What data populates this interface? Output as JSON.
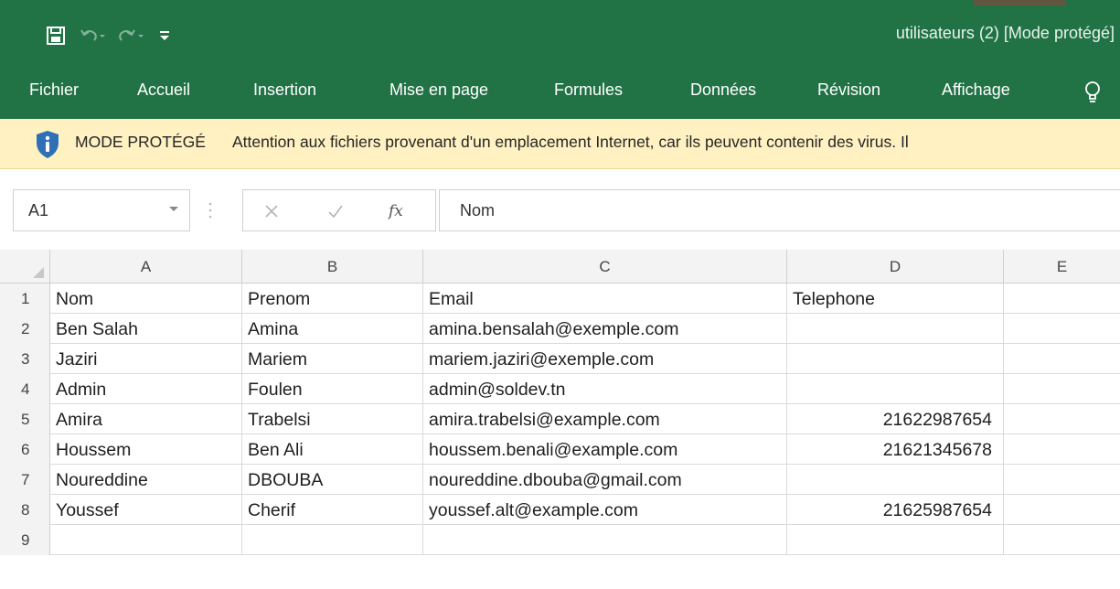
{
  "window": {
    "title": "utilisateurs (2)  [Mode protégé]"
  },
  "quick_access": {
    "save_icon": "save-icon",
    "undo_icon": "undo-icon",
    "redo_icon": "redo-icon",
    "customize_icon": "customize-qat-icon"
  },
  "ribbon": {
    "tabs": [
      {
        "label": "Fichier"
      },
      {
        "label": "Accueil"
      },
      {
        "label": "Insertion"
      },
      {
        "label": "Mise en page"
      },
      {
        "label": "Formules"
      },
      {
        "label": "Données"
      },
      {
        "label": "Révision"
      },
      {
        "label": "Affichage"
      }
    ],
    "tell_me_icon": "lightbulb-icon"
  },
  "protected_view": {
    "title": "MODE PROTÉGÉ",
    "message": "Attention aux fichiers provenant d'un emplacement Internet, car ils peuvent contenir des virus. Il"
  },
  "formula_bar": {
    "name_box": "A1",
    "formula": "Nom",
    "fx_label": "fx"
  },
  "sheet": {
    "columns": [
      "A",
      "B",
      "C",
      "D",
      "E"
    ],
    "rows": [
      {
        "num": "1",
        "cells": [
          "Nom",
          "Prenom",
          "Email",
          "Telephone",
          ""
        ]
      },
      {
        "num": "2",
        "cells": [
          "Ben Salah",
          "Amina",
          "amina.bensalah@exemple.com",
          "",
          ""
        ]
      },
      {
        "num": "3",
        "cells": [
          "Jaziri",
          "Mariem",
          "mariem.jaziri@exemple.com",
          "",
          ""
        ]
      },
      {
        "num": "4",
        "cells": [
          "Admin",
          "Foulen",
          "admin@soldev.tn",
          "",
          ""
        ]
      },
      {
        "num": "5",
        "cells": [
          "Amira",
          "Trabelsi",
          "amira.trabelsi@example.com",
          "21622987654",
          ""
        ]
      },
      {
        "num": "6",
        "cells": [
          "Houssem",
          "Ben Ali",
          "houssem.benali@example.com",
          "21621345678",
          ""
        ]
      },
      {
        "num": "7",
        "cells": [
          "Noureddine",
          "DBOUBA",
          "noureddine.dbouba@gmail.com",
          "",
          ""
        ]
      },
      {
        "num": "8",
        "cells": [
          "Youssef",
          "Cherif",
          "youssef.alt@example.com",
          "21625987654",
          ""
        ]
      },
      {
        "num": "9",
        "cells": [
          "",
          "",
          "",
          "",
          ""
        ]
      }
    ]
  },
  "colors": {
    "excel_green": "#217346",
    "protected_bar": "#fff1c1",
    "shield_blue": "#2f6fb6"
  }
}
